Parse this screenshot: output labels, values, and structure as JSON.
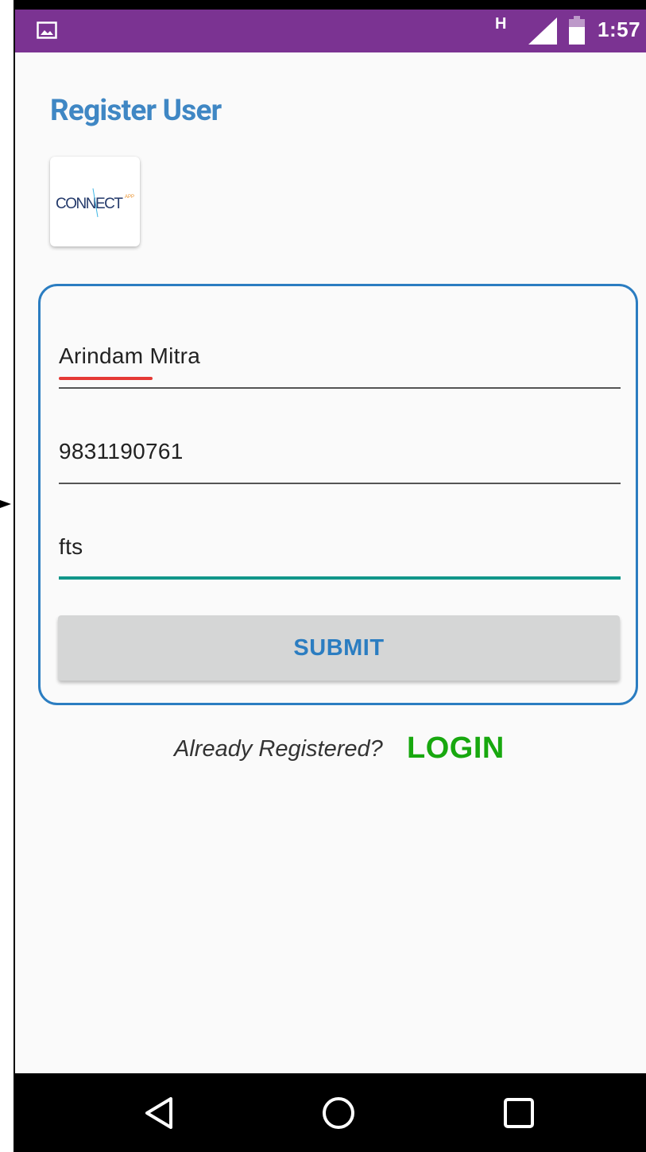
{
  "status_bar": {
    "network_type": "H",
    "time": "1:57",
    "icons": [
      "image-icon",
      "signal-icon",
      "battery-icon"
    ]
  },
  "page": {
    "title": "Register User",
    "logo_text": "CONNECT",
    "logo_superscript": "APP"
  },
  "form": {
    "name_value": "Arindam Mitra",
    "phone_value": "9831190761",
    "third_value": "fts",
    "submit_label": "SUBMIT"
  },
  "footer": {
    "already_text": "Already Registered?",
    "login_label": "LOGIN"
  },
  "nav_bar": {
    "icons": [
      "back-icon",
      "home-icon",
      "recents-icon"
    ]
  },
  "colors": {
    "status_bar": "#7b3392",
    "title": "#3f87c4",
    "card_border": "#2b7dc1",
    "active_underline": "#11968a",
    "spell_underline": "#e53935",
    "login": "#18a80f",
    "button_bg": "#d5d6d6"
  }
}
